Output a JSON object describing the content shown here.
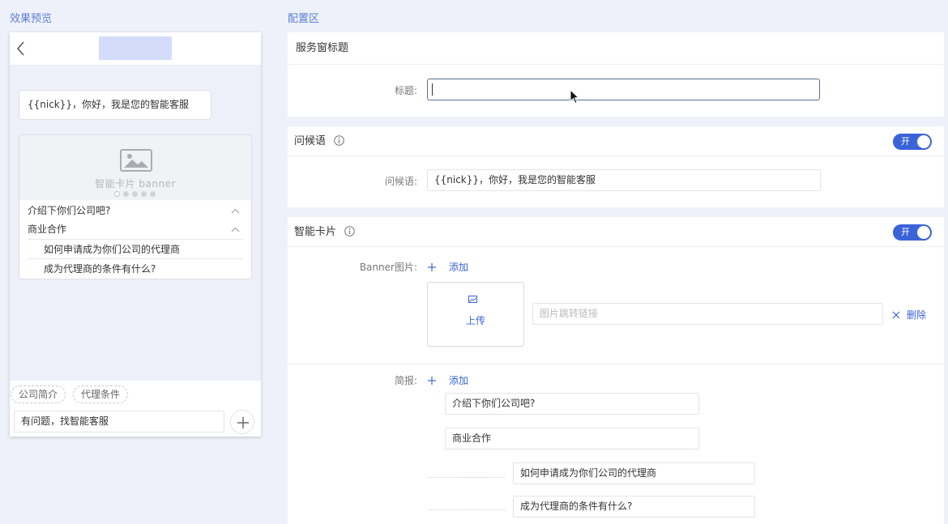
{
  "preview": {
    "section_label": "效果预览",
    "greeting": "{{nick}}，你好，我是您的智能客服",
    "card": {
      "banner_text": "智能卡片 banner",
      "items": [
        {
          "label": "介绍下你们公司吧?"
        },
        {
          "label": "商业合作"
        }
      ],
      "subitems": [
        {
          "label": "如何申请成为你们公司的代理商"
        },
        {
          "label": "成为代理商的条件有什么?"
        }
      ]
    },
    "chips": [
      "公司简介",
      "代理条件"
    ],
    "input_value": "有问题，找智能客服"
  },
  "config": {
    "section_label": "配置区",
    "title_panel": {
      "header": "服务窗标题",
      "title_label": "标题:",
      "title_value": ""
    },
    "greeting_panel": {
      "header": "问候语",
      "toggle_label": "开",
      "greeting_label": "问候语:",
      "greeting_value": "{{nick}}，你好，我是您的智能客服"
    },
    "card_panel": {
      "header": "智能卡片",
      "toggle_label": "开",
      "banner_label": "Banner图片:",
      "add_label": "添加",
      "upload_label": "上传",
      "link_placeholder": "图片跳转链接",
      "delete_label": "删除",
      "brief_label": "简报:",
      "brief_add_label": "添加",
      "brief_items": [
        "介绍下你们公司吧?",
        "商业合作"
      ],
      "brief_subitems": [
        "如何申请成为你们公司的代理商",
        "成为代理商的条件有什么?"
      ]
    }
  },
  "colors": {
    "accent": "#3a63d8",
    "section_label": "#5b7fd6",
    "background": "#eef1f9",
    "title_placeholder": "#d3dcfa"
  }
}
